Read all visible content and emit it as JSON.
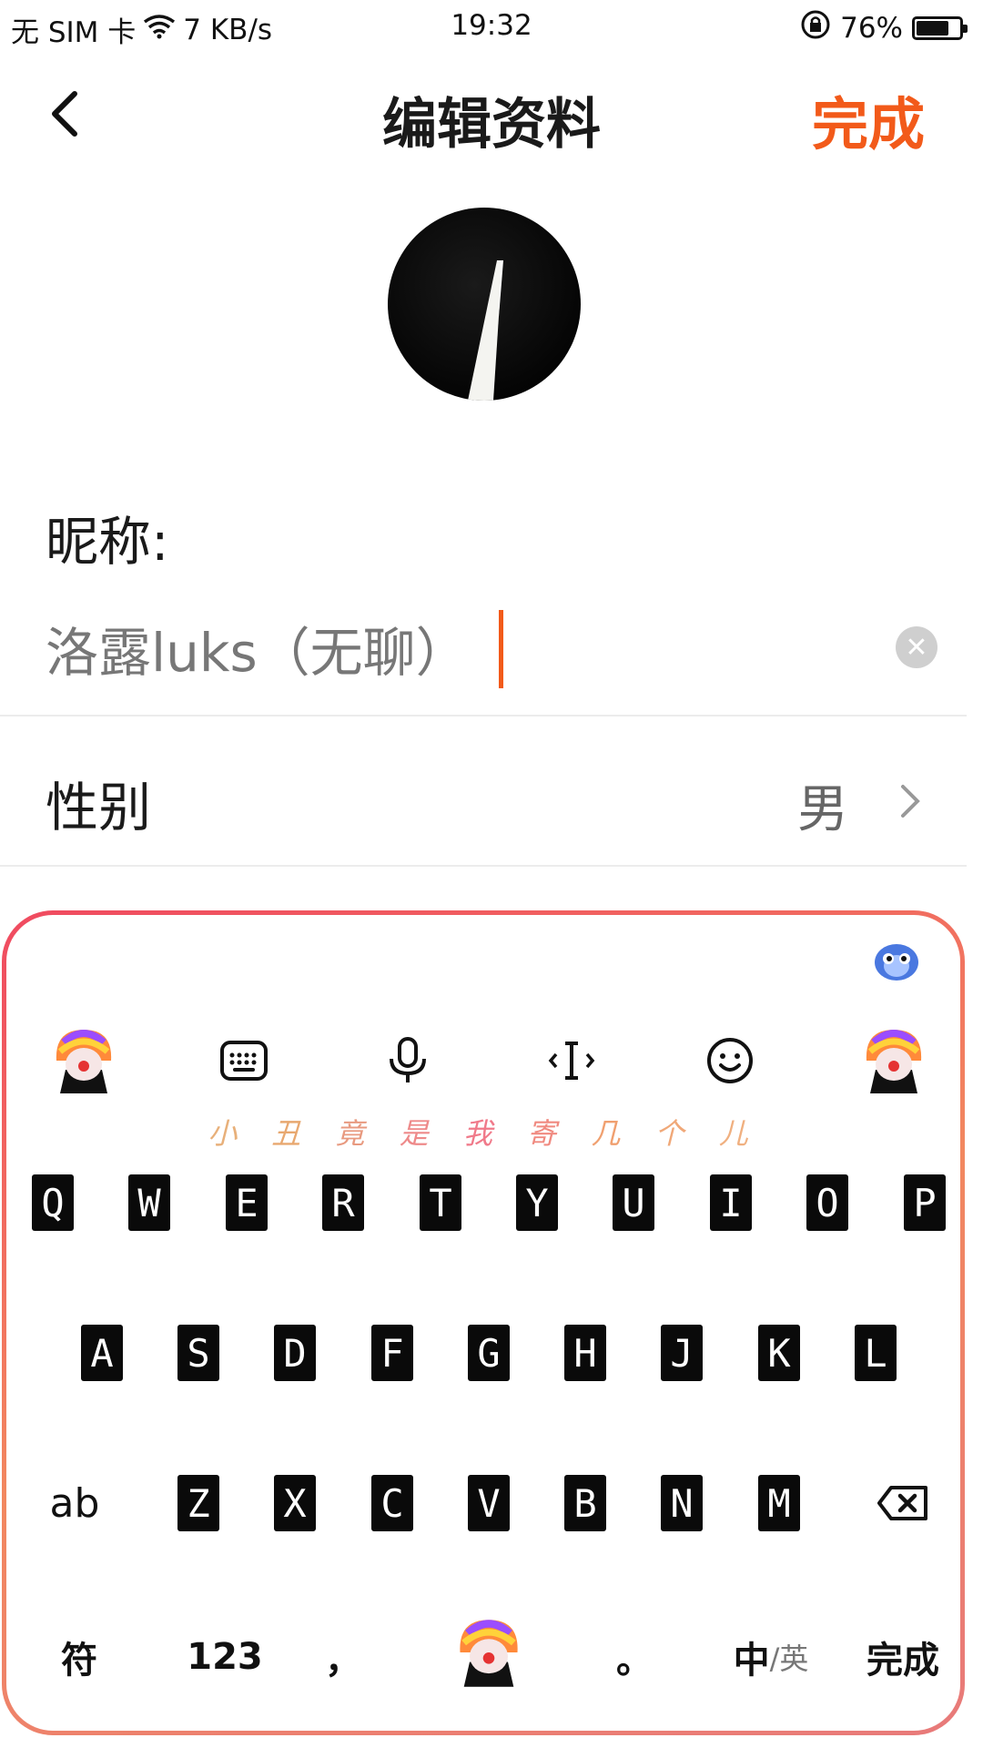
{
  "status_bar": {
    "sim": "无 SIM 卡",
    "net_speed": "7 KB/s",
    "time": "19:32",
    "battery": "76%",
    "icons": [
      "wifi-icon",
      "rotation-lock-icon",
      "battery-icon"
    ]
  },
  "nav": {
    "title": "编辑资料",
    "done": "完成",
    "back_icon": "chevron-left-icon"
  },
  "profile": {
    "nickname_label": "昵称:",
    "nickname_value": "洛露luks（无聊）",
    "gender_label": "性别",
    "gender_value": "男"
  },
  "keyboard": {
    "slogan": [
      "小",
      "丑",
      "竟",
      "是",
      "我",
      "寄",
      "几",
      "个",
      "儿"
    ],
    "row1": [
      "Q",
      "W",
      "E",
      "R",
      "T",
      "Y",
      "U",
      "I",
      "O",
      "P"
    ],
    "row2": [
      "A",
      "S",
      "D",
      "F",
      "G",
      "H",
      "J",
      "K",
      "L"
    ],
    "row3": [
      "Z",
      "X",
      "C",
      "V",
      "B",
      "N",
      "M"
    ],
    "shift_label": "ab",
    "bottom": {
      "symbols": "符",
      "numbers": "123",
      "comma": "，",
      "period": "。",
      "mode_cn": "中",
      "mode_sep": "/英",
      "done": "完成"
    }
  },
  "colors": {
    "accent": "#f25a1a",
    "keyboard_border_start": "#f04a60",
    "keyboard_border_end": "#e87a7a"
  }
}
